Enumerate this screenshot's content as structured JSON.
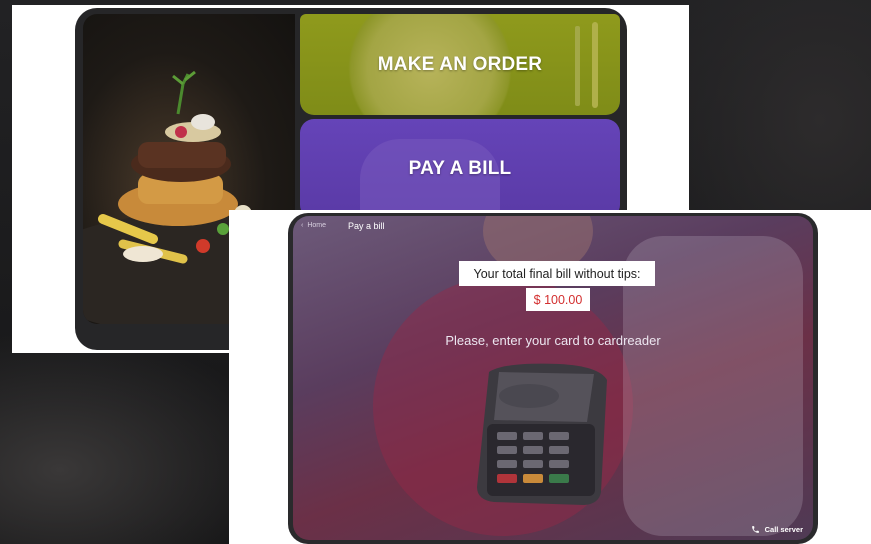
{
  "menu_screen": {
    "make_order_label": "MAKE AN ORDER",
    "pay_bill_label": "PAY A BILL"
  },
  "pay_screen": {
    "back_label": "Home",
    "title": "Pay a bill",
    "bill_label": "Your total final bill without tips:",
    "bill_amount": "$ 100.00",
    "instruction": "Please, enter your card to cardreader",
    "call_server_label": "Call server"
  },
  "icons": {
    "back": "chevron-left-icon",
    "phone": "phone-icon"
  },
  "colors": {
    "order_button": "#8a961b",
    "pay_button": "#5f3fb0",
    "amount_text": "#d32f2f"
  }
}
